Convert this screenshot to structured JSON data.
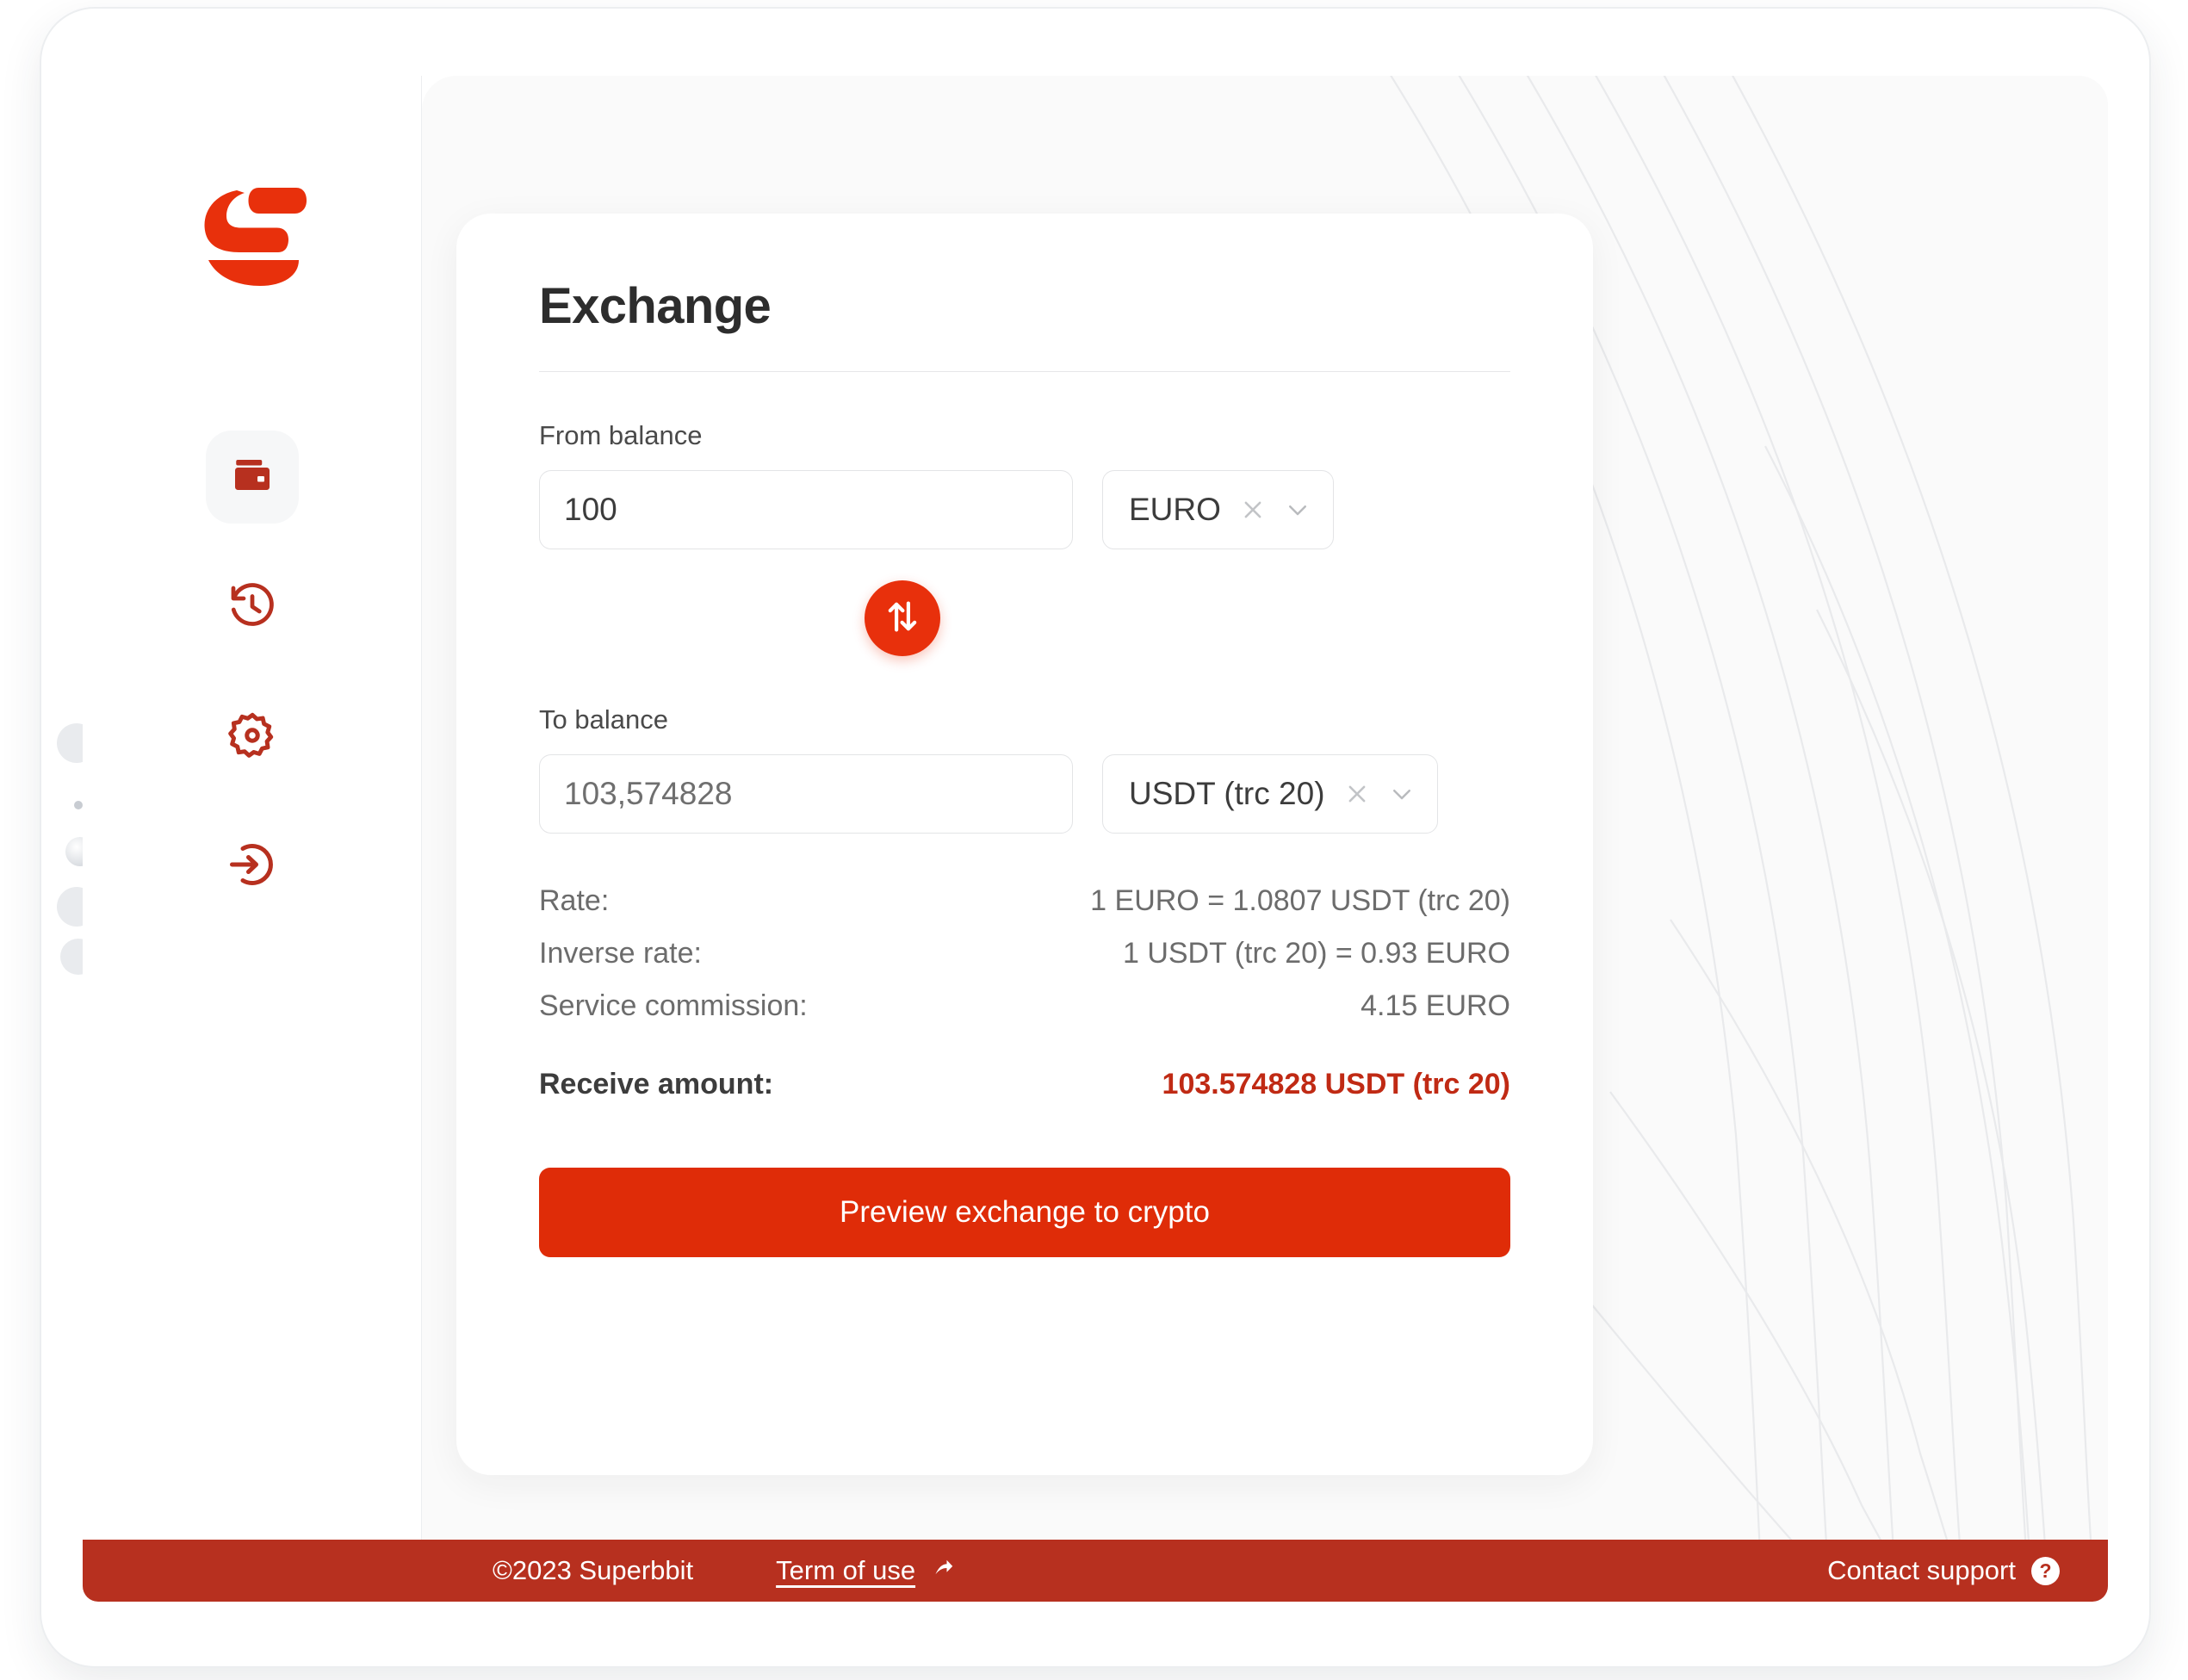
{
  "brand": {
    "name": "Superbbit",
    "logo_icon": "superbbit-s-logo",
    "accent": "#e8300c",
    "footer_red": "#b7301f",
    "cta_red": "#df2c08"
  },
  "sidebar": {
    "items": [
      {
        "icon": "wallet-icon",
        "name": "wallet",
        "active": true
      },
      {
        "icon": "history-icon",
        "name": "history",
        "active": false
      },
      {
        "icon": "settings-gear-icon",
        "name": "settings",
        "active": false
      },
      {
        "icon": "logout-icon",
        "name": "logout",
        "active": false
      }
    ]
  },
  "exchange": {
    "title": "Exchange",
    "from": {
      "label": "From balance",
      "amount": "100",
      "placeholder": "0",
      "currency": "EURO",
      "clear_icon": "close-icon",
      "chevron_icon": "chevron-down-icon"
    },
    "swap": {
      "icon": "swap-vertical-icon"
    },
    "to": {
      "label": "To balance",
      "amount": "103,574828",
      "placeholder": "0",
      "currency": "USDT (trc 20)",
      "clear_icon": "close-icon",
      "chevron_icon": "chevron-down-icon"
    },
    "details": [
      {
        "label": "Rate:",
        "value": "1 EURO = 1.0807 USDT (trc 20)"
      },
      {
        "label": "Inverse rate:",
        "value": "1 USDT (trc 20) = 0.93 EURO"
      },
      {
        "label": "Service commission:",
        "value": "4.15 EURO"
      }
    ],
    "receive": {
      "label": "Receive amount:",
      "value": "103.574828 USDT (trc 20)"
    },
    "submit_label": "Preview exchange to crypto"
  },
  "footer": {
    "copyright": "©2023 Superbbit",
    "terms_label": "Term of use",
    "terms_icon": "external-arrow-icon",
    "support_label": "Contact support",
    "support_icon": "question-mark-icon"
  }
}
